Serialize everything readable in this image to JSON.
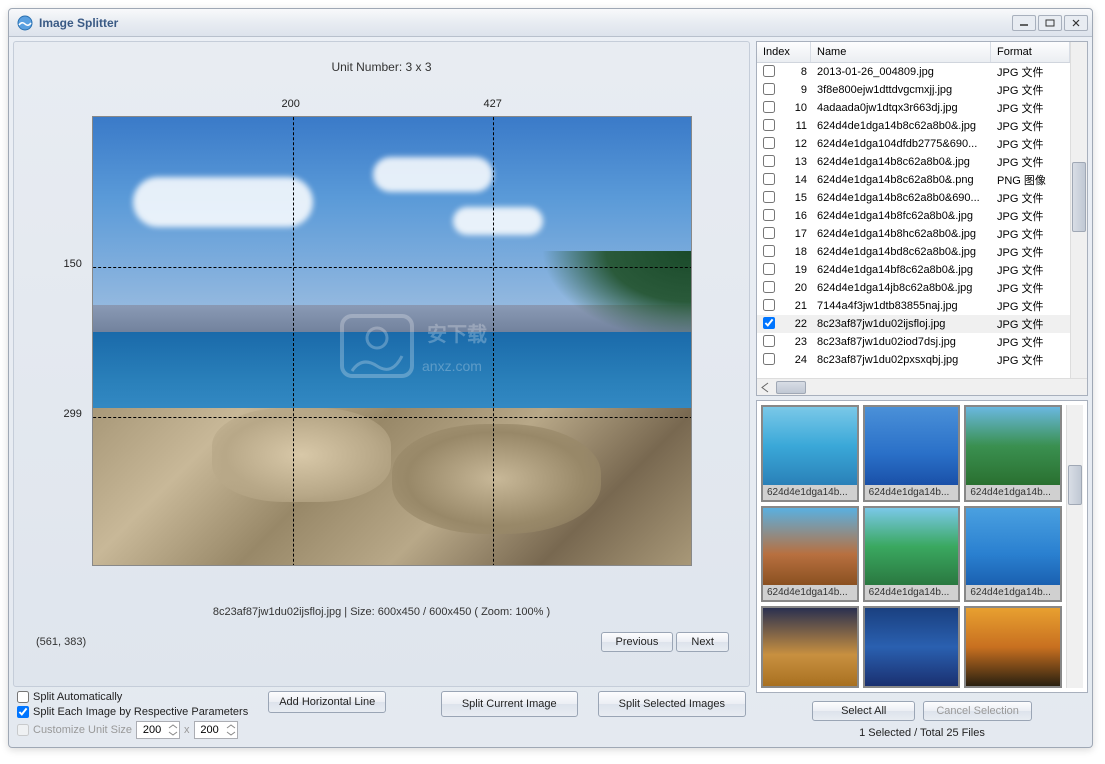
{
  "title": "Image Splitter",
  "unit_number_label": "Unit Number: 3 x 3",
  "grid_marks": {
    "v1": "200",
    "v2": "427",
    "h1": "150",
    "h2": "299"
  },
  "info_line": "8c23af87jw1du02ijsfloj.jpg  |  Size: 600x450 / 600x450 ( Zoom: 100% )",
  "coords": "(561, 383)",
  "nav": {
    "previous": "Previous",
    "next": "Next"
  },
  "buttons": {
    "add_horizontal": "Add Horizontal Line",
    "split_current": "Split Current Image",
    "split_selected": "Split Selected Images",
    "select_all": "Select All",
    "cancel_selection": "Cancel Selection"
  },
  "options": {
    "split_auto": "Split Automatically",
    "split_each": "Split Each Image by Respective Parameters",
    "customize": "Customize Unit Size",
    "w": "200",
    "h": "200",
    "x": "x"
  },
  "columns": {
    "index": "Index",
    "name": "Name",
    "format": "Format"
  },
  "files": [
    {
      "idx": "8",
      "name": "2013-01-26_004809.jpg",
      "fmt": "JPG 文件",
      "checked": false
    },
    {
      "idx": "9",
      "name": "3f8e800ejw1dttdvgcmxjj.jpg",
      "fmt": "JPG 文件",
      "checked": false
    },
    {
      "idx": "10",
      "name": "4adaada0jw1dtqx3r663dj.jpg",
      "fmt": "JPG 文件",
      "checked": false
    },
    {
      "idx": "11",
      "name": "624d4de1dga14b8c62a8b0&.jpg",
      "fmt": "JPG 文件",
      "checked": false
    },
    {
      "idx": "12",
      "name": "624d4e1dga104dfdb2775&690...",
      "fmt": "JPG 文件",
      "checked": false
    },
    {
      "idx": "13",
      "name": "624d4e1dga14b8c62a8b0&.jpg",
      "fmt": "JPG 文件",
      "checked": false
    },
    {
      "idx": "14",
      "name": "624d4e1dga14b8c62a8b0&.png",
      "fmt": "PNG 图像",
      "checked": false
    },
    {
      "idx": "15",
      "name": "624d4e1dga14b8c62a8b0&690...",
      "fmt": "JPG 文件",
      "checked": false
    },
    {
      "idx": "16",
      "name": "624d4e1dga14b8fc62a8b0&.jpg",
      "fmt": "JPG 文件",
      "checked": false
    },
    {
      "idx": "17",
      "name": "624d4e1dga14b8hc62a8b0&.jpg",
      "fmt": "JPG 文件",
      "checked": false
    },
    {
      "idx": "18",
      "name": "624d4e1dga14bd8c62a8b0&.jpg",
      "fmt": "JPG 文件",
      "checked": false
    },
    {
      "idx": "19",
      "name": "624d4e1dga14bf8c62a8b0&.jpg",
      "fmt": "JPG 文件",
      "checked": false
    },
    {
      "idx": "20",
      "name": "624d4e1dga14jb8c62a8b0&.jpg",
      "fmt": "JPG 文件",
      "checked": false
    },
    {
      "idx": "21",
      "name": "7144a4f3jw1dtb83855naj.jpg",
      "fmt": "JPG 文件",
      "checked": false
    },
    {
      "idx": "22",
      "name": "8c23af87jw1du02ijsfloj.jpg",
      "fmt": "JPG 文件",
      "checked": true,
      "selected": true
    },
    {
      "idx": "23",
      "name": "8c23af87jw1du02iod7dsj.jpg",
      "fmt": "JPG 文件",
      "checked": false
    },
    {
      "idx": "24",
      "name": "8c23af87jw1du02pxsxqbj.jpg",
      "fmt": "JPG 文件",
      "checked": false
    }
  ],
  "thumbs": [
    {
      "cap": "624d4e1dga14b..."
    },
    {
      "cap": "624d4e1dga14b..."
    },
    {
      "cap": "624d4e1dga14b..."
    },
    {
      "cap": "624d4e1dga14b..."
    },
    {
      "cap": "624d4e1dga14b..."
    },
    {
      "cap": "624d4e1dga14b..."
    },
    {
      "cap": ""
    },
    {
      "cap": ""
    },
    {
      "cap": ""
    }
  ],
  "stats": "1 Selected / Total 25 Files"
}
